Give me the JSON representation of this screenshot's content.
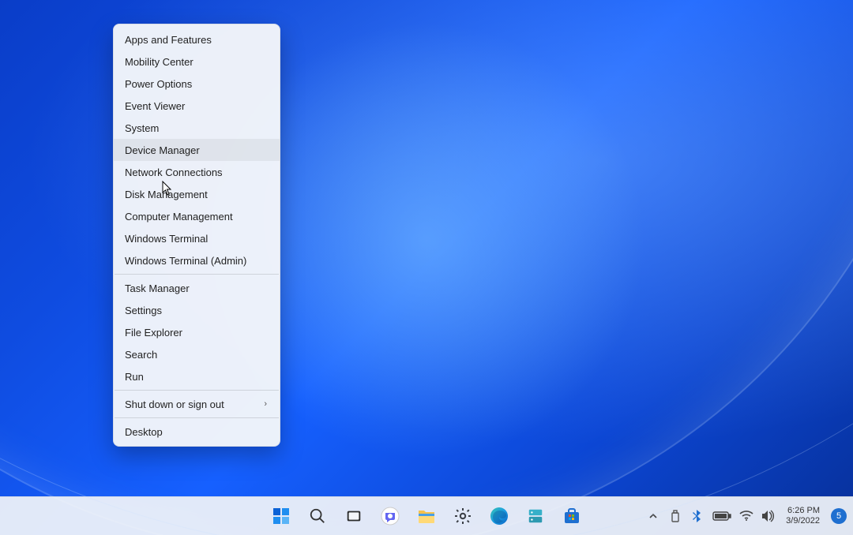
{
  "winx_menu": {
    "groups": [
      [
        {
          "label": "Apps and Features",
          "name": "menu-apps-features"
        },
        {
          "label": "Mobility Center",
          "name": "menu-mobility-center"
        },
        {
          "label": "Power Options",
          "name": "menu-power-options"
        },
        {
          "label": "Event Viewer",
          "name": "menu-event-viewer"
        },
        {
          "label": "System",
          "name": "menu-system"
        },
        {
          "label": "Device Manager",
          "name": "menu-device-manager",
          "hovered": true
        },
        {
          "label": "Network Connections",
          "name": "menu-network-connections"
        },
        {
          "label": "Disk Management",
          "name": "menu-disk-management"
        },
        {
          "label": "Computer Management",
          "name": "menu-computer-management"
        },
        {
          "label": "Windows Terminal",
          "name": "menu-windows-terminal"
        },
        {
          "label": "Windows Terminal (Admin)",
          "name": "menu-windows-terminal-admin"
        }
      ],
      [
        {
          "label": "Task Manager",
          "name": "menu-task-manager"
        },
        {
          "label": "Settings",
          "name": "menu-settings"
        },
        {
          "label": "File Explorer",
          "name": "menu-file-explorer"
        },
        {
          "label": "Search",
          "name": "menu-search"
        },
        {
          "label": "Run",
          "name": "menu-run"
        }
      ],
      [
        {
          "label": "Shut down or sign out",
          "name": "menu-shutdown-signout",
          "submenu": true
        }
      ],
      [
        {
          "label": "Desktop",
          "name": "menu-desktop"
        }
      ]
    ]
  },
  "taskbar": {
    "icons": [
      {
        "name": "start-button"
      },
      {
        "name": "search-icon"
      },
      {
        "name": "task-view-icon"
      },
      {
        "name": "chat-icon"
      },
      {
        "name": "file-explorer-icon"
      },
      {
        "name": "settings-icon"
      },
      {
        "name": "edge-icon"
      },
      {
        "name": "server-manager-icon"
      },
      {
        "name": "microsoft-store-icon"
      }
    ]
  },
  "systray": {
    "icons": [
      {
        "name": "overflow-chevron-icon"
      },
      {
        "name": "usb-eject-icon"
      },
      {
        "name": "bluetooth-icon"
      },
      {
        "name": "battery-icon"
      },
      {
        "name": "wifi-icon"
      },
      {
        "name": "volume-icon"
      }
    ],
    "clock": {
      "time": "6:26 PM",
      "date": "3/9/2022"
    },
    "notifications": {
      "count": "5"
    }
  }
}
